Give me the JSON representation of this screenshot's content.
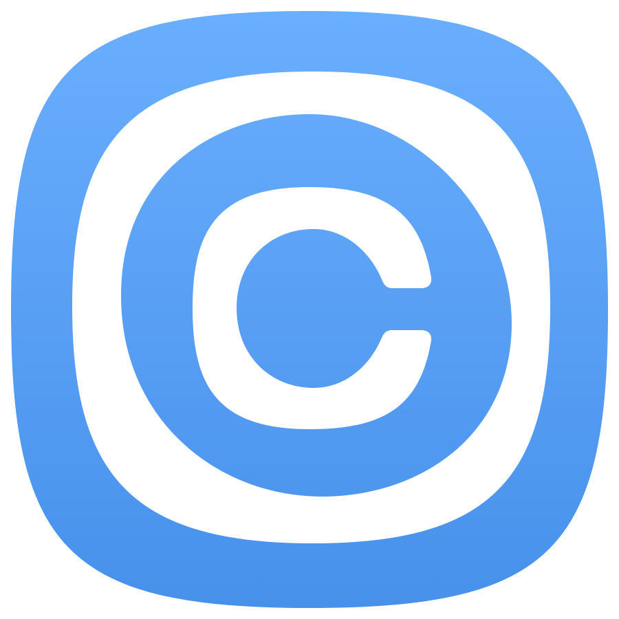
{
  "icon": {
    "name": "copyright-app-icon",
    "glyph": "C",
    "colors": {
      "gradient_top": "#6aaefe",
      "gradient_bottom": "#4791eb",
      "foreground": "#ffffff",
      "page_background": "#ffffff"
    }
  }
}
